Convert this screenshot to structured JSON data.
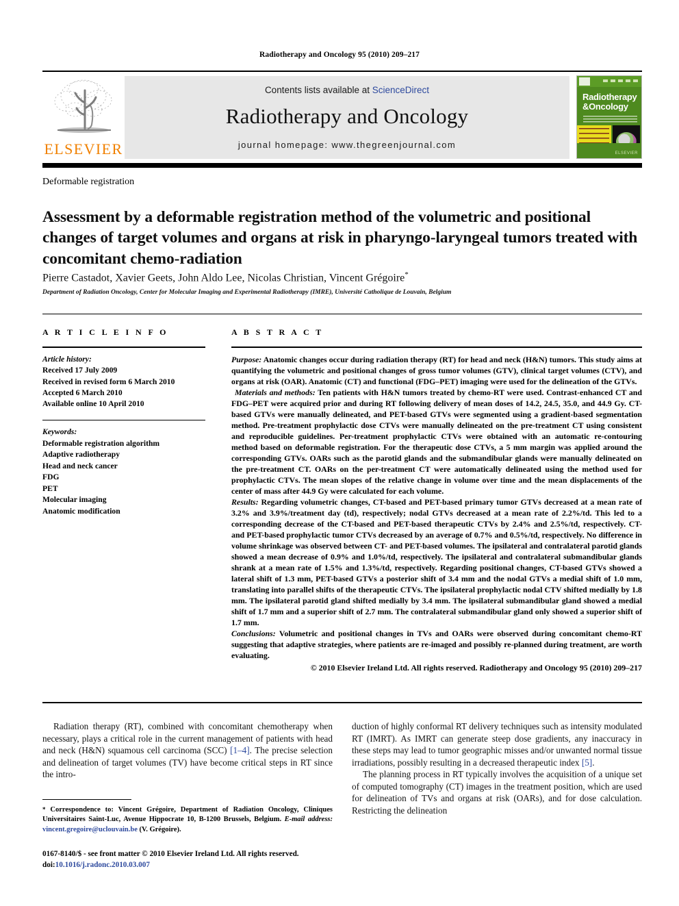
{
  "running_head": "Radiotherapy and Oncology 95 (2010) 209–217",
  "masthead": {
    "publisher_logo_text": "ELSEVIER",
    "contents_prefix": "Contents lists available at ",
    "contents_link": "ScienceDirect",
    "journal_title": "Radiotherapy and Oncology",
    "homepage_line": "journal homepage: www.thegreenjournal.com",
    "cover": {
      "line1": "Radiotherapy",
      "line2": "&Oncology",
      "footer_word": "ELSEVIER"
    }
  },
  "article": {
    "section_label": "Deformable registration",
    "title": "Assessment by a deformable registration method of the volumetric and positional changes of target volumes and organs at risk in pharyngo-laryngeal tumors treated with concomitant chemo-radiation",
    "authors": "Pierre Castadot, Xavier Geets, John Aldo Lee, Nicolas Christian, Vincent Grégoire",
    "author_marker": "*",
    "affiliation": "Department of Radiation Oncology, Center for Molecular Imaging and Experimental Radiotherapy (IMRE), Université Catholique de Louvain, Belgium"
  },
  "article_info": {
    "heading": "A R T I C L E   I N F O",
    "history_label": "Article history:",
    "history": [
      "Received 17 July 2009",
      "Received in revised form 6 March 2010",
      "Accepted 6 March 2010",
      "Available online 10 April 2010"
    ],
    "keywords_label": "Keywords:",
    "keywords": [
      "Deformable registration algorithm",
      "Adaptive radiotherapy",
      "Head and neck cancer",
      "FDG",
      "PET",
      "Molecular imaging",
      "Anatomic modification"
    ]
  },
  "abstract": {
    "heading": "A B S T R A C T",
    "purpose_label": "Purpose:",
    "purpose": " Anatomic changes occur during radiation therapy (RT) for head and neck (H&N) tumors. This study aims at quantifying the volumetric and positional changes of gross tumor volumes (GTV), clinical target volumes (CTV), and organs at risk (OAR). Anatomic (CT) and functional (FDG–PET) imaging were used for the delineation of the GTVs.",
    "methods_label": "Materials and methods:",
    "methods": " Ten patients with H&N tumors treated by chemo-RT were used. Contrast-enhanced CT and FDG–PET were acquired prior and during RT following delivery of mean doses of 14.2, 24.5, 35.0, and 44.9 Gy. CT-based GTVs were manually delineated, and PET-based GTVs were segmented using a gradient-based segmentation method. Pre-treatment prophylactic dose CTVs were manually delineated on the pre-treatment CT using consistent and reproducible guidelines. Per-treatment prophylactic CTVs were obtained with an automatic re-contouring method based on deformable registration. For the therapeutic dose CTVs, a 5 mm margin was applied around the corresponding GTVs. OARs such as the parotid glands and the submandibular glands were manually delineated on the pre-treatment CT. OARs on the per-treatment CT were automatically delineated using the method used for prophylactic CTVs. The mean slopes of the relative change in volume over time and the mean displacements of the center of mass after 44.9 Gy were calculated for each volume.",
    "results_label": "Results:",
    "results": " Regarding volumetric changes, CT-based and PET-based primary tumor GTVs decreased at a mean rate of 3.2% and 3.9%/treatment day (td), respectively; nodal GTVs decreased at a mean rate of 2.2%/td. This led to a corresponding decrease of the CT-based and PET-based therapeutic CTVs by 2.4% and 2.5%/td, respectively. CT- and PET-based prophylactic tumor CTVs decreased by an average of 0.7% and 0.5%/td, respectively. No difference in volume shrinkage was observed between CT- and PET-based volumes. The ipsilateral and contralateral parotid glands showed a mean decrease of 0.9% and 1.0%/td, respectively. The ipsilateral and contralateral submandibular glands shrank at a mean rate of 1.5% and 1.3%/td, respectively. Regarding positional changes, CT-based GTVs showed a lateral shift of 1.3 mm, PET-based GTVs a posterior shift of 3.4 mm and the nodal GTVs a medial shift of 1.0 mm, translating into parallel shifts of the therapeutic CTVs. The ipsilateral prophylactic nodal CTV shifted medially by 1.8 mm. The ipsilateral parotid gland shifted medially by 3.4 mm. The ipsilateral submandibular gland showed a medial shift of 1.7 mm and a superior shift of 2.7 mm. The contralateral submandibular gland only showed a superior shift of 1.7 mm.",
    "conclusions_label": "Conclusions:",
    "conclusions": " Volumetric and positional changes in TVs and OARs were observed during concomitant chemo-RT suggesting that adaptive strategies, where patients are re-imaged and possibly re-planned during treatment, are worth evaluating.",
    "copyright": "© 2010 Elsevier Ireland Ltd. All rights reserved. Radiotherapy and Oncology 95 (2010) 209–217"
  },
  "body": {
    "left_p1_a": "Radiation therapy (RT), combined with concomitant chemotherapy when necessary, plays a critical role in the current management of patients with head and neck (H&N) squamous cell carcinoma (SCC) ",
    "left_ref1": "[1–4]",
    "left_p1_b": ". The precise selection and delineation of target volumes (TV) have become critical steps in RT since the intro-",
    "right_p1_a": "duction of highly conformal RT delivery techniques such as intensity modulated RT (IMRT). As IMRT can generate steep dose gradients, any inaccuracy in these steps may lead to tumor geographic misses and/or unwanted normal tissue irradiations, possibly resulting in a decreased therapeutic index ",
    "right_ref1": "[5]",
    "right_p1_b": ".",
    "right_p2": "The planning process in RT typically involves the acquisition of a unique set of computed tomography (CT) images in the treatment position, which are used for delineation of TVs and organs at risk (OARs), and for dose calculation. Restricting the delineation"
  },
  "footnote": {
    "marker": "*",
    "correspondence": " Correspondence to: Vincent Grégoire, Department of Radiation Oncology, Cliniques Universitaires Saint-Luc, Avenue Hippocrate 10, B-1200 Brussels, Belgium.",
    "email_label": "E-mail address:",
    "email": "vincent.gregoire@uclouvain.be",
    "email_suffix": " (V. Grégoire)."
  },
  "footer": {
    "issn_line": "0167-8140/$ - see front matter © 2010 Elsevier Ireland Ltd. All rights reserved.",
    "doi_label": "doi:",
    "doi_value": "10.1016/j.radonc.2010.03.007"
  },
  "colors": {
    "elsevier_orange": "#f08000",
    "link_blue": "#2e4a9e",
    "band_gray": "#e7e7e7",
    "cover_green": "#4e8a1f",
    "cover_yellow": "#e8dc1e"
  }
}
